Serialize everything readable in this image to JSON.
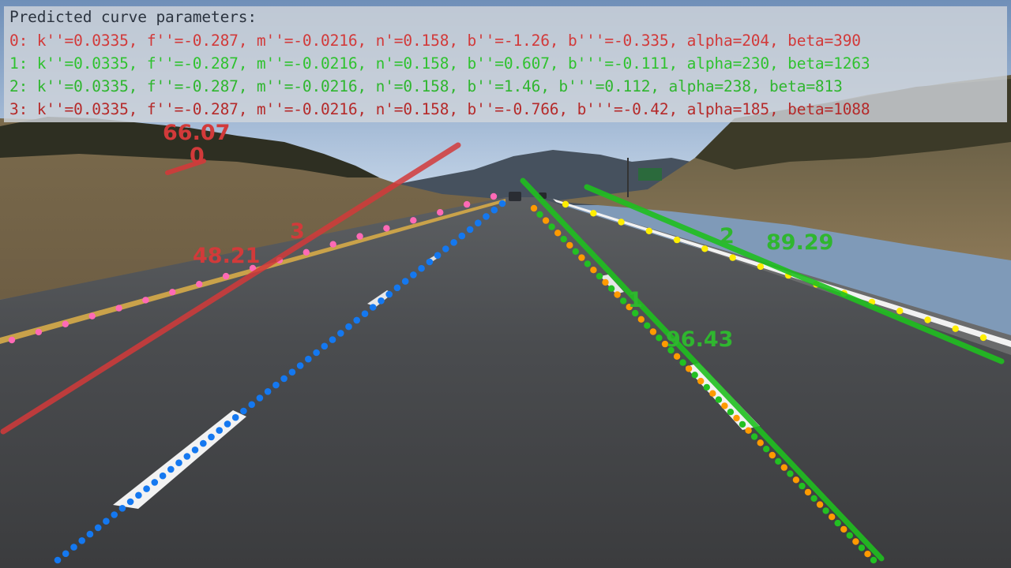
{
  "panel": {
    "title": "Predicted curve parameters:",
    "lines": [
      {
        "text": "0: k''=0.0335, f''=-0.287, m''=-0.0216, n'=0.158, b''=-1.26, b'''=-0.335, alpha=204, beta=390",
        "color": "#d23a3a"
      },
      {
        "text": "1: k''=0.0335, f''=-0.287, m''=-0.0216, n'=0.158, b''=0.607, b'''=-0.111, alpha=230, beta=1263",
        "color": "#2fc22f"
      },
      {
        "text": "2: k''=0.0335, f''=-0.287, m''=-0.0216, n'=0.158, b''=1.46, b'''=0.112, alpha=238, beta=813",
        "color": "#2fb62f"
      },
      {
        "text": "3: k''=0.0335, f''=-0.287, m''=-0.0216, n'=0.158, b''=-0.766, b'''=-0.42, alpha=185, beta=1088",
        "color": "#b52a2a"
      }
    ]
  },
  "lane_labels": {
    "lane_0_id": "0",
    "lane_0_score": "66.07",
    "lane_1_id": "1",
    "lane_1_score": "96.43",
    "lane_2_id": "2",
    "lane_2_score": "89.29",
    "lane_3_id": "3",
    "lane_3_score": "48.21"
  },
  "colors": {
    "predicted_bad": "#d84046",
    "predicted_good": "#22c022",
    "gt_pink": "#ff6ab6",
    "gt_blue": "#1478f0",
    "gt_orange": "#ff9a00",
    "gt_yellow": "#ffee00"
  }
}
